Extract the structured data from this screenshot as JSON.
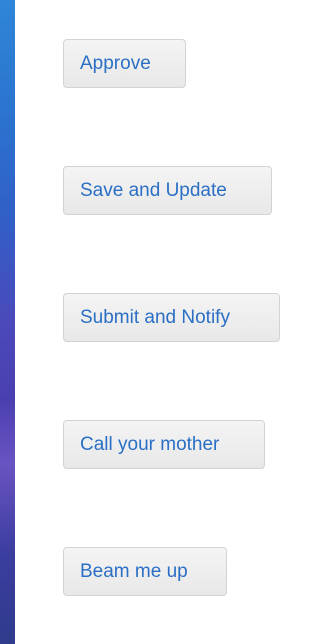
{
  "buttons": {
    "approve": "Approve",
    "save_update": "Save and Update",
    "submit_notify": "Submit and Notify",
    "call_mother": "Call your mother",
    "beam_up": "Beam me up"
  },
  "colors": {
    "button_text": "#2a6fc5",
    "button_bg": "#ececec",
    "button_border": "#d3d3d3"
  }
}
